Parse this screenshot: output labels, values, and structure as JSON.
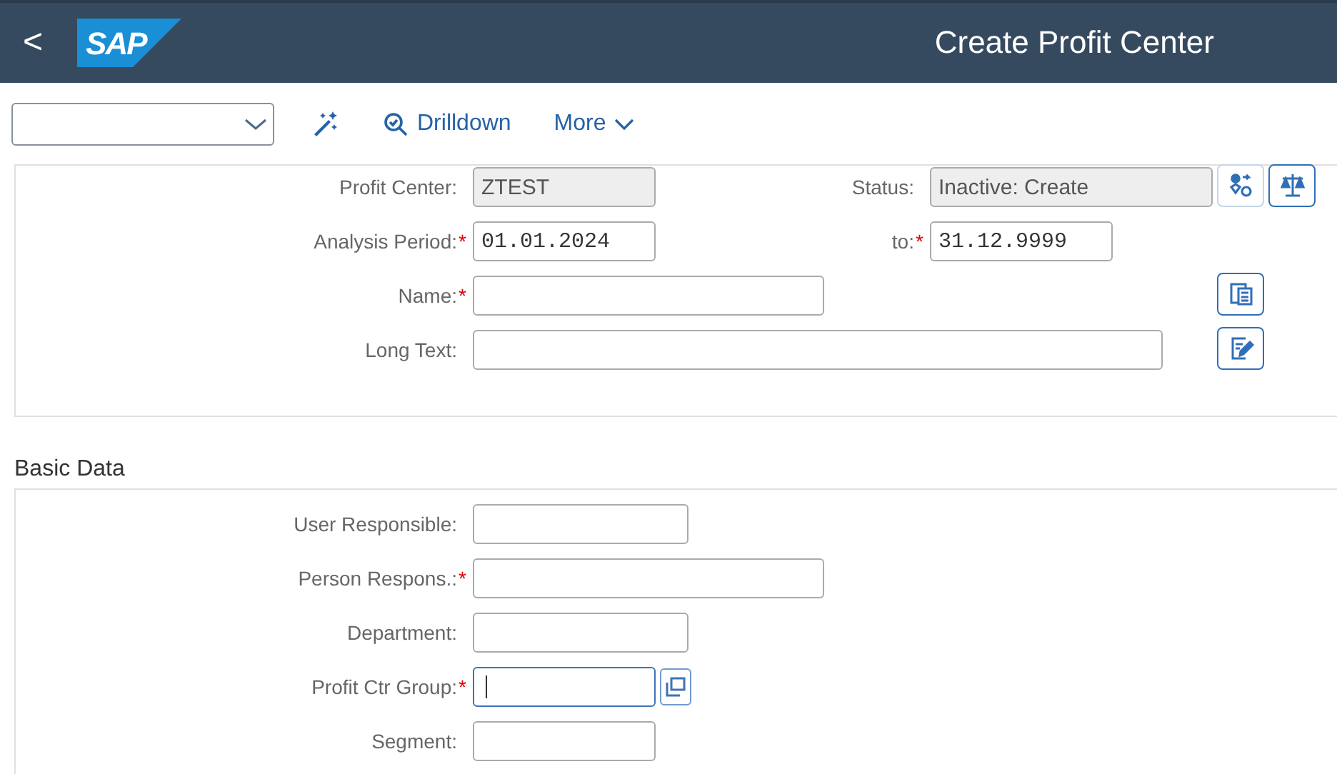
{
  "shell": {
    "back": "<",
    "logo": "SAP",
    "title": "Create Profit Center"
  },
  "toolbar": {
    "items": [
      {
        "kind": "wand"
      },
      {
        "kind": "search",
        "label": "Drilldown"
      },
      {
        "kind": "more",
        "label": "More"
      }
    ]
  },
  "header_section": {
    "rows": [
      {
        "fields": [
          {
            "label": "Profit Center:",
            "value": "ZTEST",
            "disabled": true,
            "kind": "short"
          },
          {
            "label": "Status:",
            "value": "Inactive: Create",
            "disabled": true,
            "kind": "status"
          }
        ],
        "actions": [
          {
            "kind": "people",
            "disabled": true
          },
          {
            "kind": "balance",
            "disabled": false
          }
        ]
      },
      {
        "fields": [
          {
            "label": "Analysis Period:",
            "required_mark": "*",
            "value": "01.01.2024",
            "kind": "date"
          },
          {
            "label": "to:",
            "required_mark": "*",
            "value": "31.12.9999",
            "kind": "date"
          }
        ],
        "actions": []
      },
      {
        "fields": [
          {
            "label": "Name:",
            "required_mark": "*",
            "kind": "long"
          }
        ],
        "actions": [
          {
            "kind": "copy",
            "disabled": false
          }
        ]
      },
      {
        "fields": [
          {
            "label": "Long Text:",
            "kind": "wide"
          }
        ],
        "actions": [
          {
            "kind": "edit",
            "disabled": false
          }
        ]
      }
    ]
  },
  "basic_data": {
    "title": "Basic Data",
    "rows": [
      {
        "fields": [
          {
            "label": "User Responsible:",
            "kind": "medium"
          }
        ],
        "actions": []
      },
      {
        "fields": [
          {
            "label": "Person Respons.:",
            "required_mark": "*",
            "kind": "long"
          }
        ],
        "actions": []
      },
      {
        "fields": [
          {
            "label": "Department:",
            "kind": "medium"
          }
        ],
        "actions": []
      },
      {
        "fields": [
          {
            "label": "Profit Ctr Group:",
            "required_mark": "*",
            "focused": true,
            "value_help": true,
            "kind": "short"
          }
        ],
        "actions": []
      },
      {
        "fields": [
          {
            "label": "Segment:",
            "kind": "short"
          }
        ],
        "actions": []
      }
    ]
  }
}
